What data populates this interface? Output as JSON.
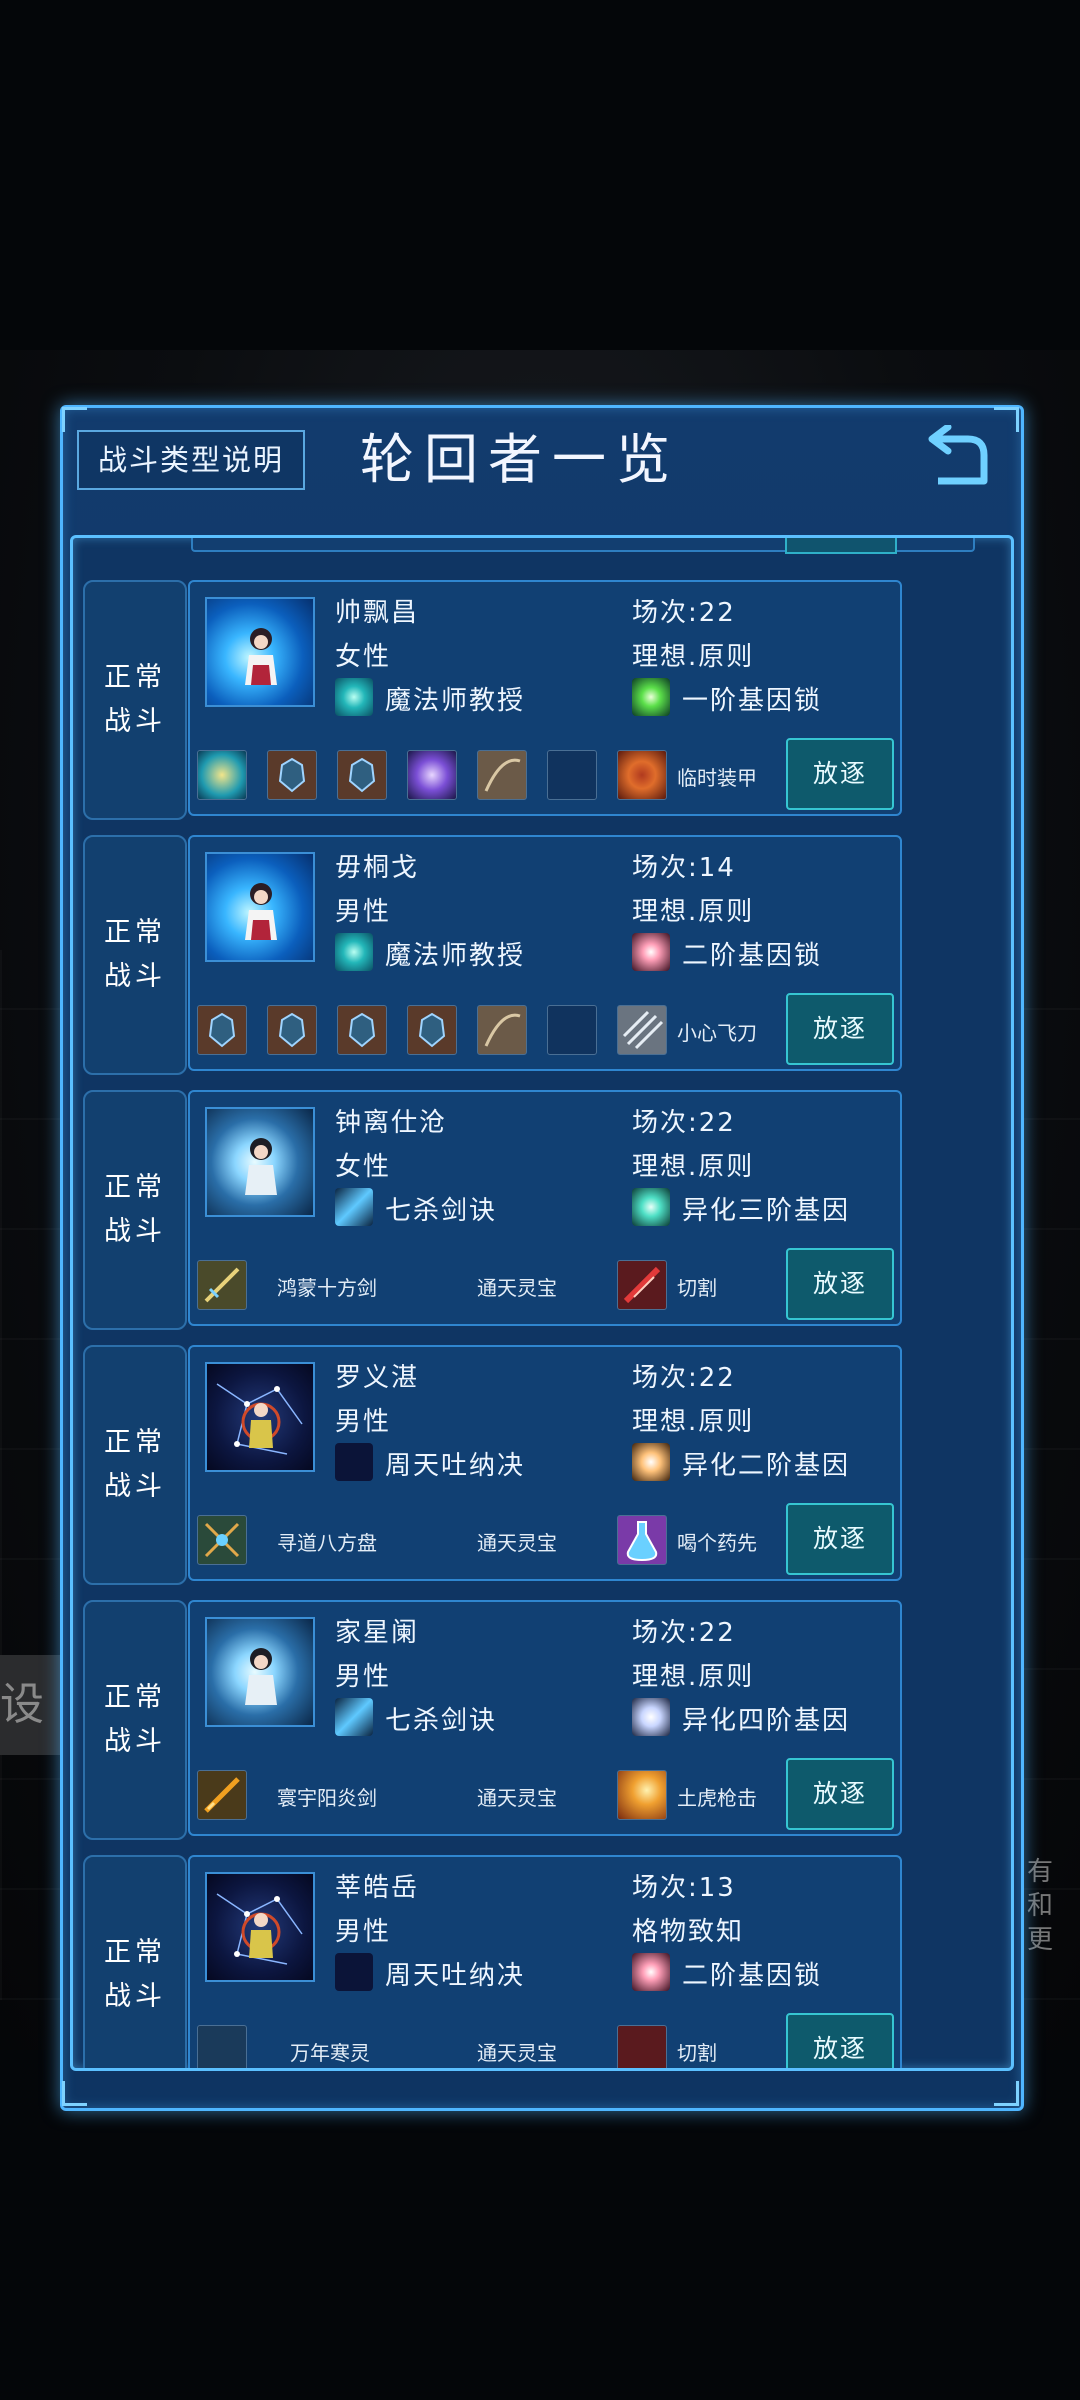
{
  "header": {
    "title": "轮回者一览",
    "help_button": "战斗类型说明"
  },
  "background": {
    "left_fragment": "设",
    "right_fragment": "有和更"
  },
  "rows": [
    {
      "type": "正常战斗",
      "type_l1": "正常",
      "type_l2": "战斗",
      "name": "帅飘昌",
      "gender": "女性",
      "sessions": "场次:22",
      "ideal": "理想.原则",
      "skill1": "魔法师教授",
      "skill2": "一阶基因锁",
      "equip_text": [
        "",
        "",
        "临时装甲"
      ],
      "exile": "放逐"
    },
    {
      "type_l1": "正常",
      "type_l2": "战斗",
      "name": "毋桐戈",
      "gender": "男性",
      "sessions": "场次:14",
      "ideal": "理想.原则",
      "skill1": "魔法师教授",
      "skill2": "二阶基因锁",
      "equip_text": [
        "",
        "",
        "小心飞刀"
      ],
      "exile": "放逐"
    },
    {
      "type_l1": "正常",
      "type_l2": "战斗",
      "name": "钟离仕沧",
      "gender": "女性",
      "sessions": "场次:22",
      "ideal": "理想.原则",
      "skill1": "七杀剑诀",
      "skill2": "异化三阶基因",
      "equip_text": [
        "鸿蒙十方剑",
        "通天灵宝",
        "切割"
      ],
      "exile": "放逐"
    },
    {
      "type_l1": "正常",
      "type_l2": "战斗",
      "name": "罗义湛",
      "gender": "男性",
      "sessions": "场次:22",
      "ideal": "理想.原则",
      "skill1": "周天吐纳决",
      "skill2": "异化二阶基因",
      "equip_text": [
        "寻道八方盘",
        "通天灵宝",
        "喝个药先"
      ],
      "exile": "放逐"
    },
    {
      "type_l1": "正常",
      "type_l2": "战斗",
      "name": "家星阑",
      "gender": "男性",
      "sessions": "场次:22",
      "ideal": "理想.原则",
      "skill1": "七杀剑诀",
      "skill2": "异化四阶基因",
      "equip_text": [
        "寰宇阳炎剑",
        "通天灵宝",
        "土虎枪击"
      ],
      "exile": "放逐"
    },
    {
      "type_l1": "正常",
      "type_l2": "战斗",
      "name": "莘皓岳",
      "gender": "男性",
      "sessions": "场次:13",
      "ideal": "格物致知",
      "skill1": "周天吐纳决",
      "skill2": "二阶基因锁",
      "equip_text": [
        "万年寒灵",
        "通天灵宝",
        "切割"
      ],
      "exile": "放逐"
    }
  ]
}
